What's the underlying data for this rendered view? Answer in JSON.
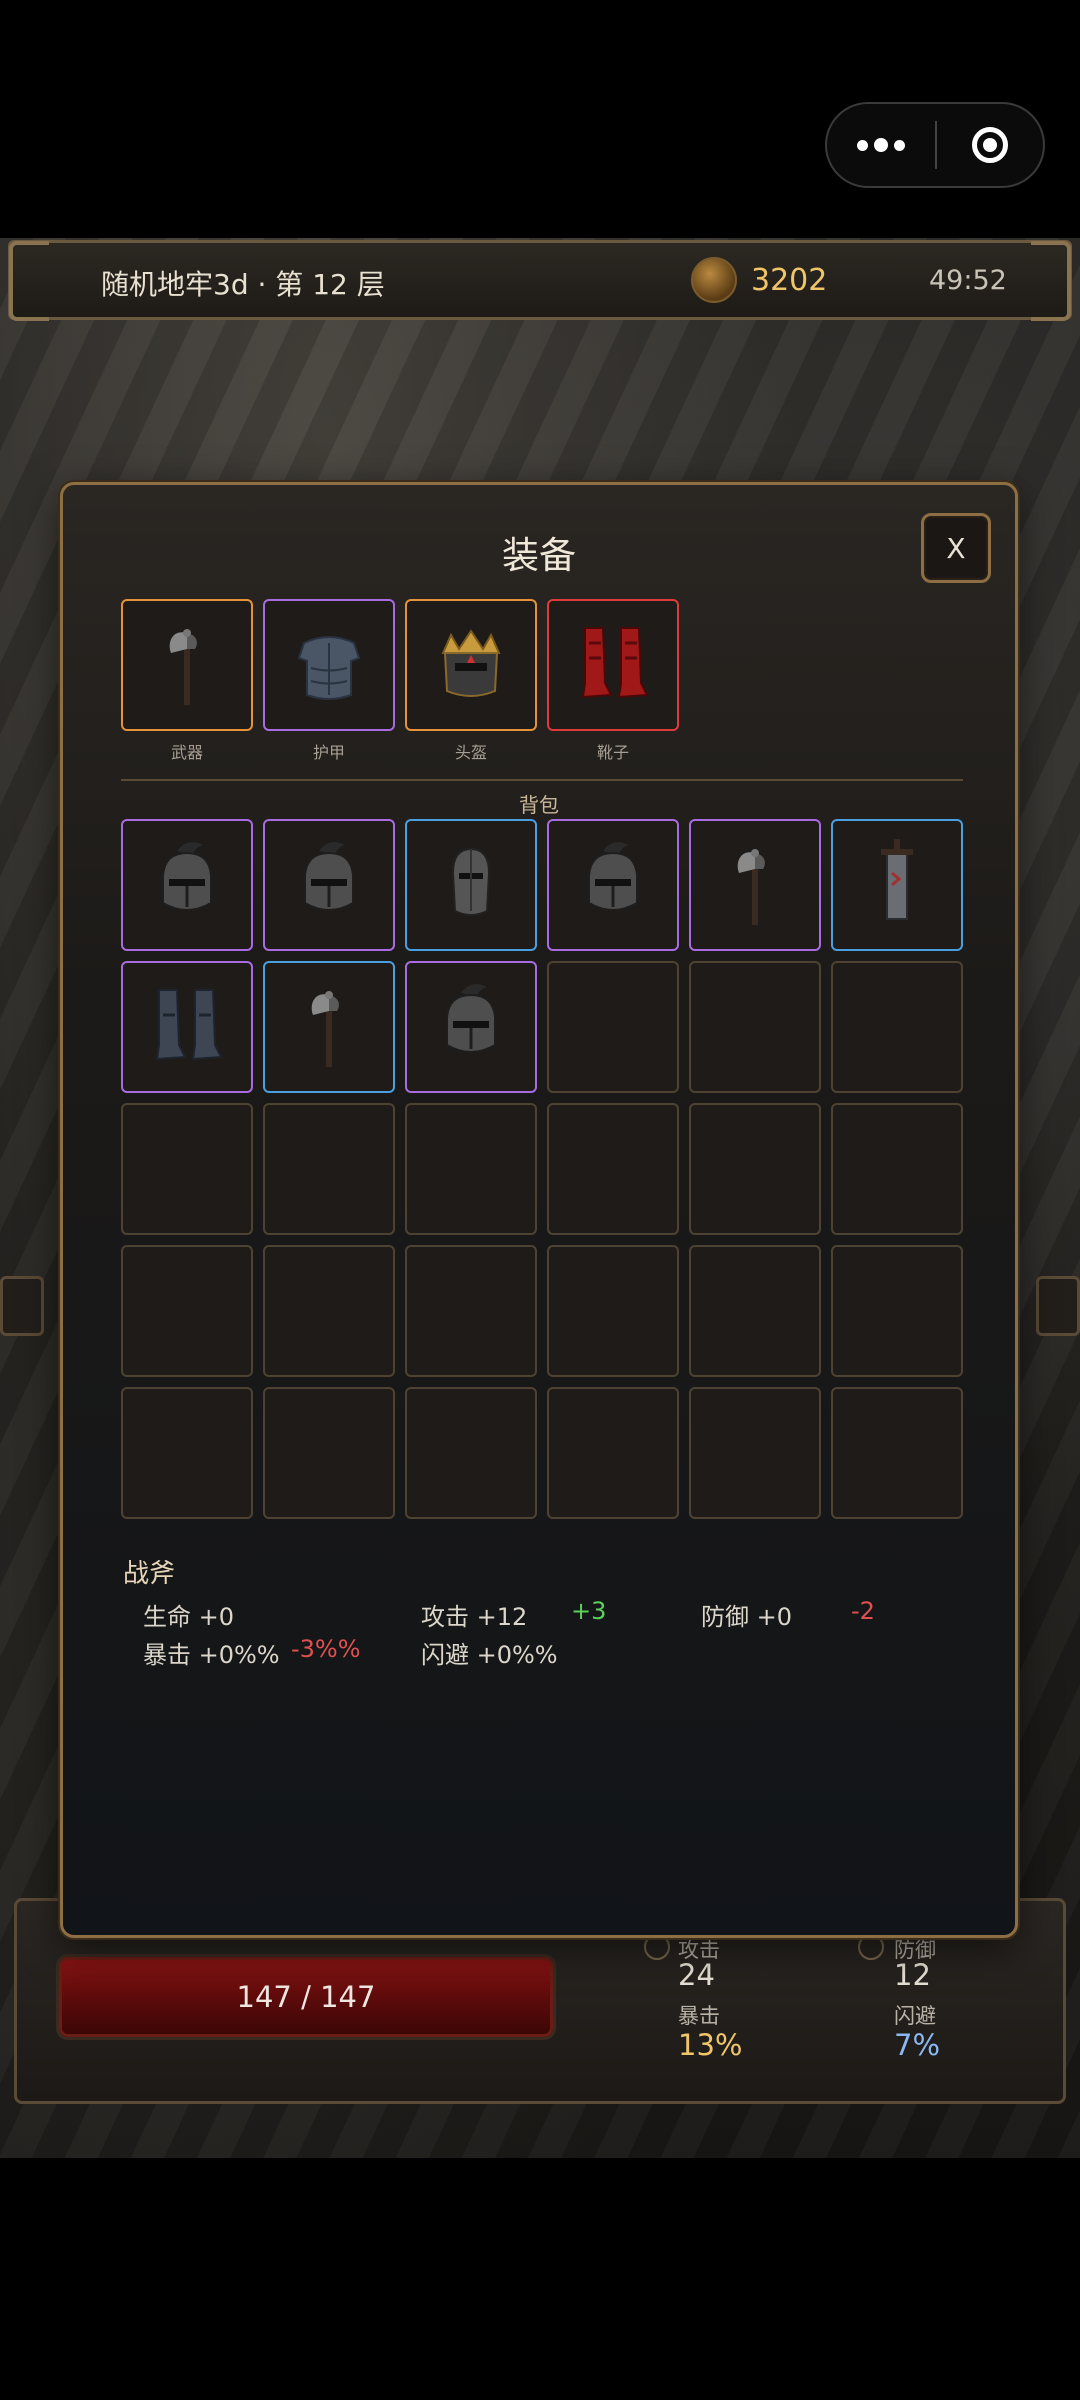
{
  "capsule": {},
  "topbar": {
    "title": "随机地牢3d · 第 12 层",
    "gold": "3202",
    "timer": "49:52"
  },
  "bottom": {
    "hp": "147 / 147",
    "attack_label": "攻击",
    "attack_value": "24",
    "defense_label": "防御",
    "defense_value": "12",
    "crit_label": "暴击",
    "crit_value": "13%",
    "dodge_label": "闪避",
    "dodge_value": "7%",
    "colors": {
      "crit": "#f0c56a",
      "dodge": "#8ab8f0"
    }
  },
  "modal": {
    "title": "装备",
    "close_label": "X",
    "equipped": [
      {
        "label": "武器",
        "item": "axe",
        "rarity": "orange"
      },
      {
        "label": "护甲",
        "item": "armor",
        "rarity": "purple"
      },
      {
        "label": "头盔",
        "item": "crown-helmet",
        "rarity": "orange"
      },
      {
        "label": "靴子",
        "item": "red-boots",
        "rarity": "red"
      }
    ],
    "backpack_label": "背包",
    "backpack": [
      {
        "item": "plumed-helmet",
        "rarity": "purple"
      },
      {
        "item": "plumed-helmet",
        "rarity": "purple"
      },
      {
        "item": "knight-helmet",
        "rarity": "blue"
      },
      {
        "item": "plumed-helmet",
        "rarity": "purple"
      },
      {
        "item": "axe",
        "rarity": "purple"
      },
      {
        "item": "sword",
        "rarity": "blue"
      },
      {
        "item": "steel-boots",
        "rarity": "purple"
      },
      {
        "item": "axe",
        "rarity": "blue"
      },
      {
        "item": "plumed-helmet",
        "rarity": "purple"
      },
      null,
      null,
      null,
      null,
      null,
      null,
      null,
      null,
      null,
      null,
      null,
      null,
      null,
      null,
      null,
      null,
      null,
      null,
      null,
      null,
      null
    ],
    "detail": {
      "name": "战斧",
      "hp": "生命 +0",
      "attack": "攻击 +12",
      "attack_delta": "+3",
      "defense": "防御 +0",
      "defense_delta": "-2",
      "crit": "暴击 +0%%",
      "crit_delta": "-3%%",
      "dodge": "闪避 +0%%"
    },
    "rarity_colors": {
      "orange": "#e5923a",
      "purple": "#a86be0",
      "blue": "#4a9fe0",
      "red": "#e03a3a"
    }
  }
}
